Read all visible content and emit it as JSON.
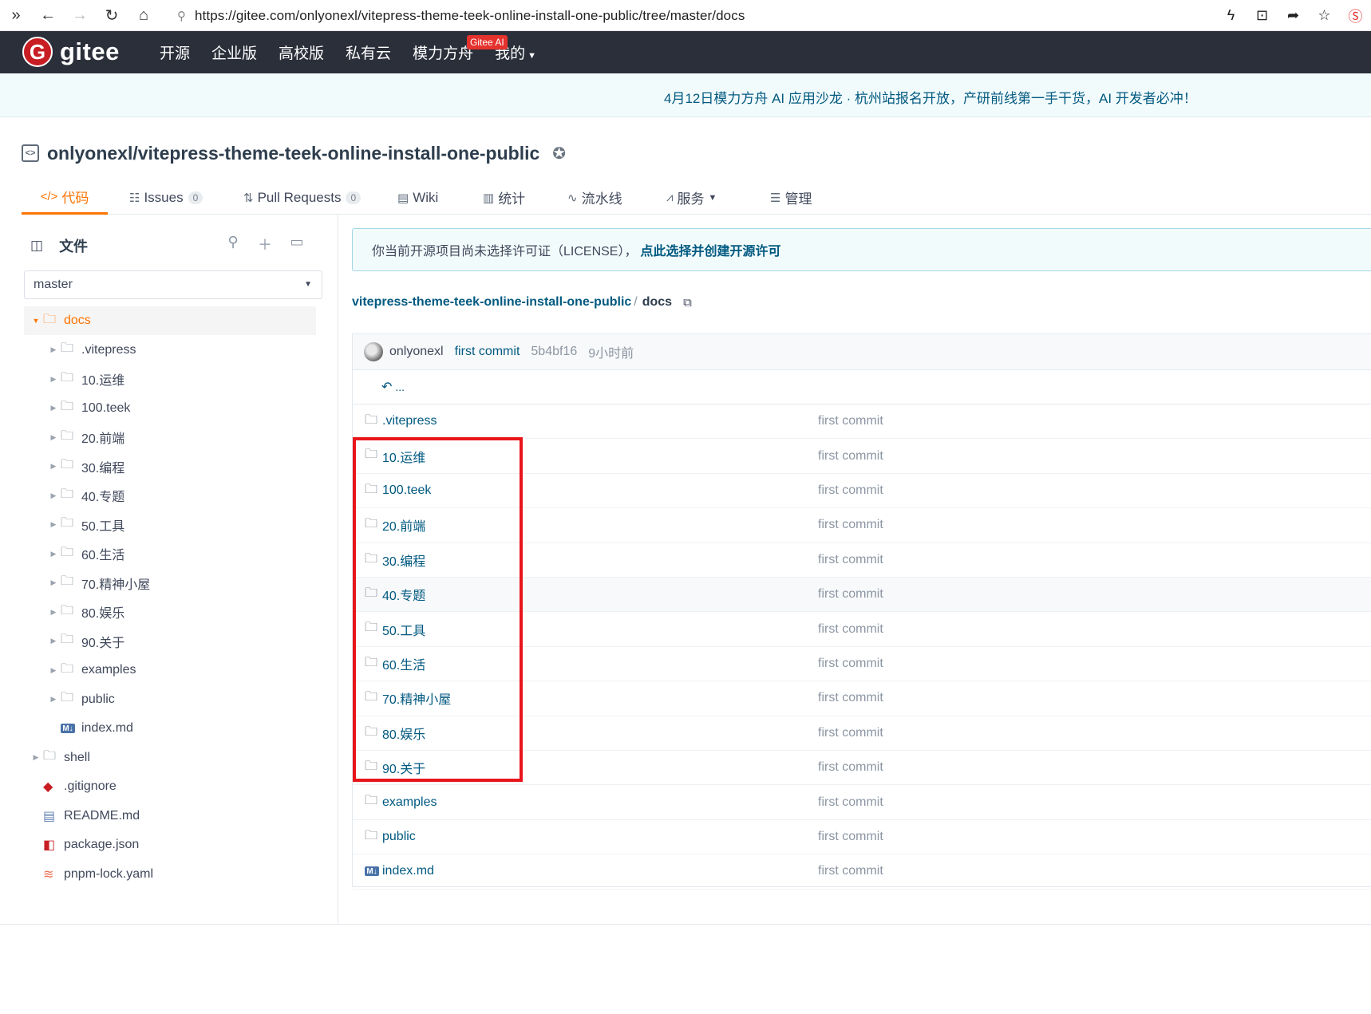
{
  "browser": {
    "url": "https://gitee.com/onlyonexl/vitepress-theme-teek-online-install-one-public/tree/master/docs",
    "nav_icons": [
      "expand-icon",
      "back-icon",
      "forward-icon",
      "reload-icon",
      "home-icon"
    ],
    "right_icons": [
      "bolt-icon",
      "extension-icon",
      "share-icon",
      "star-icon",
      "s-logo-icon"
    ]
  },
  "topnav": {
    "logo_text": "gitee",
    "items": [
      "开源",
      "企业版",
      "高校版",
      "私有云",
      "模力方舟"
    ],
    "ai_badge": "Gitee AI",
    "mine": "我的"
  },
  "announcement": "4月12日模力方舟 AI 应用沙龙 · 杭州站报名开放，产研前线第一手干货，AI 开发者必冲！",
  "repo": {
    "title": "onlyonexl/vitepress-theme-teek-online-install-one-public"
  },
  "tabs": [
    {
      "label": "代码",
      "icon": "</>"
    },
    {
      "label": "Issues",
      "icon": "☷",
      "count": "0"
    },
    {
      "label": "Pull Requests",
      "icon": "⇅",
      "count": "0"
    },
    {
      "label": "Wiki",
      "icon": "▤"
    },
    {
      "label": "统计",
      "icon": "▥"
    },
    {
      "label": "流水线",
      "icon": "∿"
    },
    {
      "label": "服务",
      "icon": "⩘"
    },
    {
      "label": "管理",
      "icon": "☰"
    }
  ],
  "sidebar": {
    "files_label": "文件",
    "branch": "master",
    "tree": [
      {
        "name": "docs",
        "type": "folder",
        "depth": 0,
        "expanded": true
      },
      {
        "name": ".vitepress",
        "type": "folder",
        "depth": 1
      },
      {
        "name": "10.运维",
        "type": "folder",
        "depth": 1
      },
      {
        "name": "100.teek",
        "type": "folder",
        "depth": 1
      },
      {
        "name": "20.前端",
        "type": "folder",
        "depth": 1
      },
      {
        "name": "30.编程",
        "type": "folder",
        "depth": 1
      },
      {
        "name": "40.专题",
        "type": "folder",
        "depth": 1
      },
      {
        "name": "50.工具",
        "type": "folder",
        "depth": 1
      },
      {
        "name": "60.生活",
        "type": "folder",
        "depth": 1
      },
      {
        "name": "70.精神小屋",
        "type": "folder",
        "depth": 1
      },
      {
        "name": "80.娱乐",
        "type": "folder",
        "depth": 1
      },
      {
        "name": "90.关于",
        "type": "folder",
        "depth": 1
      },
      {
        "name": "examples",
        "type": "folder",
        "depth": 1
      },
      {
        "name": "public",
        "type": "folder",
        "depth": 1
      },
      {
        "name": "index.md",
        "type": "md",
        "depth": 1
      },
      {
        "name": "shell",
        "type": "folder",
        "depth": 0
      },
      {
        "name": ".gitignore",
        "type": "git",
        "depth": 0
      },
      {
        "name": "README.md",
        "type": "book",
        "depth": 0
      },
      {
        "name": "package.json",
        "type": "pkg",
        "depth": 0
      },
      {
        "name": "pnpm-lock.yaml",
        "type": "lock",
        "depth": 0
      }
    ]
  },
  "license_notice": {
    "text": "你当前开源项目尚未选择许可证（LICENSE），",
    "link": "点此选择并创建开源许可"
  },
  "breadcrumb": {
    "repo": "vitepress-theme-teek-online-install-one-public",
    "sep": "/",
    "current": "docs"
  },
  "commit": {
    "author": "onlyonexl",
    "message": "first commit",
    "sha": "5b4bf16",
    "time": "9小时前"
  },
  "up_label": "...",
  "files": [
    {
      "name": ".vitepress",
      "type": "folder",
      "msg": "first commit"
    },
    {
      "name": "10.运维",
      "type": "folder",
      "msg": "first commit"
    },
    {
      "name": "100.teek",
      "type": "folder",
      "msg": "first commit"
    },
    {
      "name": "20.前端",
      "type": "folder",
      "msg": "first commit"
    },
    {
      "name": "30.编程",
      "type": "folder",
      "msg": "first commit"
    },
    {
      "name": "40.专题",
      "type": "folder",
      "msg": "first commit"
    },
    {
      "name": "50.工具",
      "type": "folder",
      "msg": "first commit"
    },
    {
      "name": "60.生活",
      "type": "folder",
      "msg": "first commit"
    },
    {
      "name": "70.精神小屋",
      "type": "folder",
      "msg": "first commit"
    },
    {
      "name": "80.娱乐",
      "type": "folder",
      "msg": "first commit"
    },
    {
      "name": "90.关于",
      "type": "folder",
      "msg": "first commit"
    },
    {
      "name": "examples",
      "type": "folder",
      "msg": "first commit"
    },
    {
      "name": "public",
      "type": "folder",
      "msg": "first commit"
    },
    {
      "name": "index.md",
      "type": "md",
      "msg": "first commit"
    }
  ],
  "colors": {
    "accent": "#fe7300",
    "link": "#005980",
    "nav_bg": "#2b2f3a",
    "brand_red": "#c71d23",
    "annotation_red": "#e8151b"
  }
}
